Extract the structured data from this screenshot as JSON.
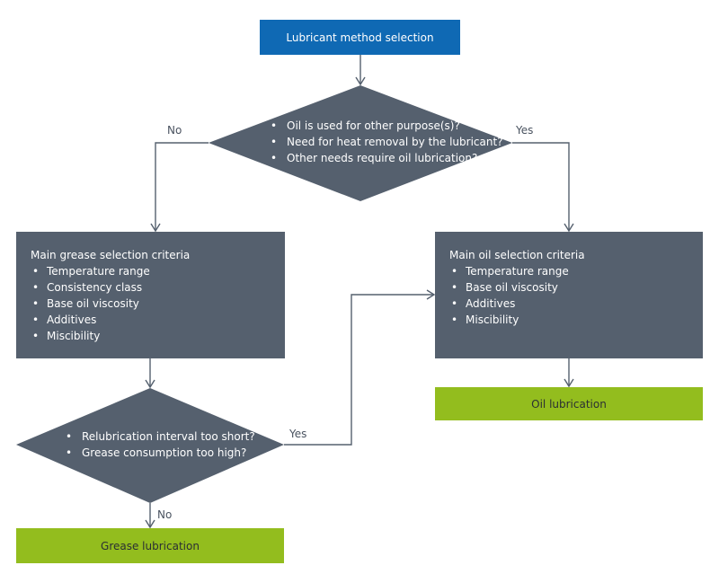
{
  "colors": {
    "start": "#0f69b4",
    "process": "#55606e",
    "result": "#93bd1e",
    "connector": "#55606e"
  },
  "start": {
    "label": "Lubricant method selection"
  },
  "decision1": {
    "items": [
      "Oil is used for other purpose(s)?",
      "Need for heat removal by the lubricant?",
      "Other needs require oil lubrication?"
    ],
    "no_label": "No",
    "yes_label": "Yes"
  },
  "grease_criteria": {
    "title": "Main grease selection criteria",
    "items": [
      "Temperature range",
      "Consistency class",
      "Base oil viscosity",
      "Additives",
      "Miscibility"
    ]
  },
  "oil_criteria": {
    "title": "Main oil selection criteria",
    "items": [
      "Temperature range",
      "Base oil viscosity",
      "Additives",
      "Miscibility"
    ]
  },
  "decision2": {
    "items": [
      "Relubrication interval too short?",
      "Grease consumption too high?"
    ],
    "yes_label": "Yes",
    "no_label": "No"
  },
  "oil_result": {
    "label": "Oil lubrication"
  },
  "grease_result": {
    "label": "Grease lubrication"
  }
}
